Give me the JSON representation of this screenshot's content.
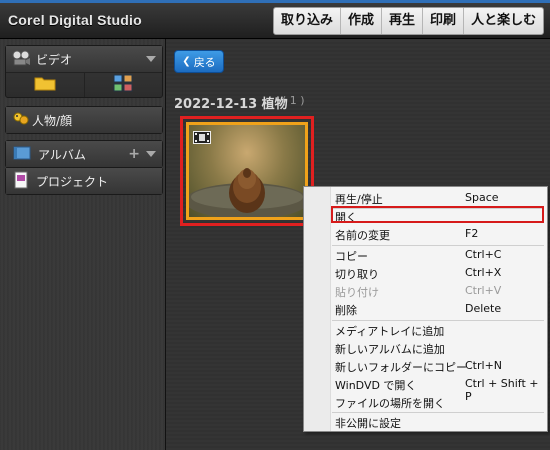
{
  "app": {
    "title": "Corel Digital Studio"
  },
  "menu": {
    "items": [
      "取り込み",
      "作成",
      "再生",
      "印刷",
      "人と楽しむ"
    ]
  },
  "sidebar": {
    "video": {
      "label": "ビデオ"
    },
    "people": {
      "label": "人物/顔"
    },
    "album": {
      "label": "アルバム"
    },
    "project": {
      "label": "プロジェクト"
    }
  },
  "main": {
    "back_label": "戻る",
    "section_title": "2022-12-13 植物",
    "section_count": "( 1 )"
  },
  "context_menu": {
    "items": [
      {
        "label": "再生/停止",
        "shortcut": "Space"
      },
      {
        "label": "開く",
        "shortcut": ""
      },
      {
        "label": "名前の変更",
        "shortcut": "F2"
      },
      {
        "label": "コピー",
        "shortcut": "Ctrl+C"
      },
      {
        "label": "切り取り",
        "shortcut": "Ctrl+X"
      },
      {
        "label": "貼り付け",
        "shortcut": "Ctrl+V"
      },
      {
        "label": "削除",
        "shortcut": "Delete"
      },
      {
        "label": "メディアトレイに追加",
        "shortcut": ""
      },
      {
        "label": "新しいアルバムに追加",
        "shortcut": ""
      },
      {
        "label": "新しいフォルダーにコピー",
        "shortcut": "Ctrl+N"
      },
      {
        "label": "WinDVD で開く",
        "shortcut": "Ctrl + Shift + P"
      },
      {
        "label": "ファイルの場所を開く",
        "shortcut": ""
      },
      {
        "label": "非公開に設定",
        "shortcut": ""
      }
    ]
  },
  "colors": {
    "highlight": "#d61a1a",
    "selection": "#f0a21a",
    "accent": "#1c6cc1"
  }
}
